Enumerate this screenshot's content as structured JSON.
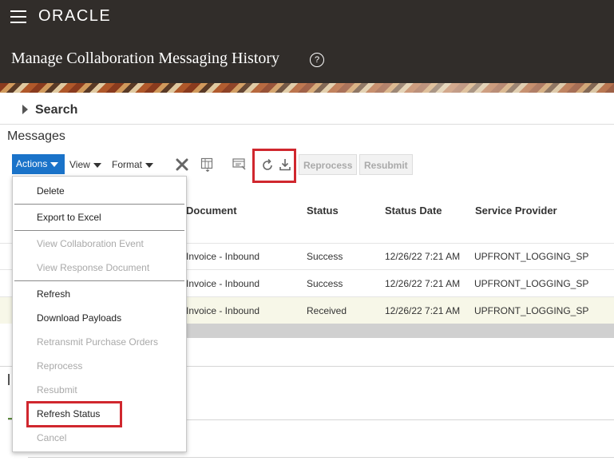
{
  "app": {
    "logo": "ORACLE"
  },
  "header": {
    "title": "Manage Collaboration Messaging History",
    "help_glyph": "?"
  },
  "search": {
    "label": "Search"
  },
  "messages": {
    "title": "Messages"
  },
  "toolbar": {
    "actions_label": "Actions",
    "view_label": "View",
    "format_label": "Format",
    "reprocess_label": "Reprocess",
    "resubmit_label": "Resubmit",
    "icons": [
      "close-icon",
      "freeze-icon",
      "detach-icon",
      "refresh-icon",
      "download-icon"
    ]
  },
  "table": {
    "columns": [
      "Document",
      "Status",
      "Status Date",
      "Service Provider"
    ],
    "rows": [
      {
        "document": "Invoice - Inbound",
        "status": "Success",
        "status_date": "12/26/22 7:21 AM",
        "provider": "UPFRONT_LOGGING_SP"
      },
      {
        "document": "Invoice - Inbound",
        "status": "Success",
        "status_date": "12/26/22 7:21 AM",
        "provider": "UPFRONT_LOGGING_SP"
      },
      {
        "document": "Invoice - Inbound",
        "status": "Received",
        "status_date": "12/26/22 7:21 AM",
        "provider": "UPFRONT_LOGGING_SP"
      }
    ]
  },
  "actions_menu": {
    "items": [
      {
        "label": "Delete",
        "enabled": true
      },
      {
        "label": "Export to Excel",
        "enabled": true
      },
      {
        "label": "View Collaboration Event",
        "enabled": false
      },
      {
        "label": "View Response Document",
        "enabled": false
      },
      {
        "label": "Refresh",
        "enabled": true
      },
      {
        "label": "Download Payloads",
        "enabled": true
      },
      {
        "label": "Retransmit Purchase Orders",
        "enabled": false
      },
      {
        "label": "Reprocess",
        "enabled": false
      },
      {
        "label": "Resubmit",
        "enabled": false
      },
      {
        "label": "Refresh Status",
        "enabled": true
      },
      {
        "label": "Cancel",
        "enabled": false
      }
    ]
  },
  "colors": {
    "header_bg": "#312d2a",
    "accent": "#1a73c9",
    "highlight": "#d0272e",
    "selected_row": "#f7f7e8"
  }
}
